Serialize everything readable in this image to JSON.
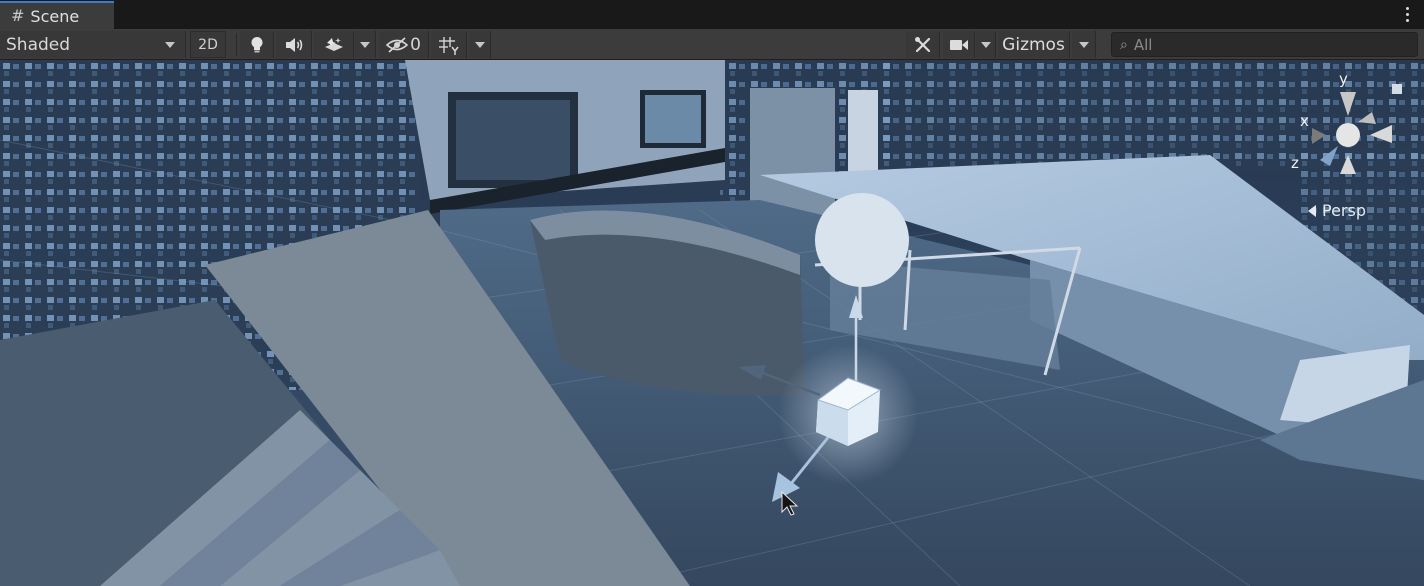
{
  "tab": {
    "icon": "grid-hash-icon",
    "label": "Scene"
  },
  "toolbar": {
    "draw_mode": "Shaded",
    "mode_2d": "2D",
    "hidden_count": "0",
    "gizmos_label": "Gizmos",
    "search_placeholder": "All"
  },
  "icons": {
    "lighting": "lightbulb-icon",
    "audio": "speaker-icon",
    "effects": "effects-icon",
    "visibility": "eye-slash-icon",
    "grid": "grid-snap-icon",
    "tools": "tools-icon",
    "camera": "camera-icon",
    "search": "search-icon",
    "menu": "kebab-menu-icon"
  },
  "orientation_gizmo": {
    "x_label": "x",
    "y_label": "y",
    "z_label": "z",
    "projection": "Persp"
  },
  "colors": {
    "tab_accent": "#3a7cc7",
    "toolbar_bg": "#3c3c3c",
    "scene_tint": "#5b7795"
  }
}
